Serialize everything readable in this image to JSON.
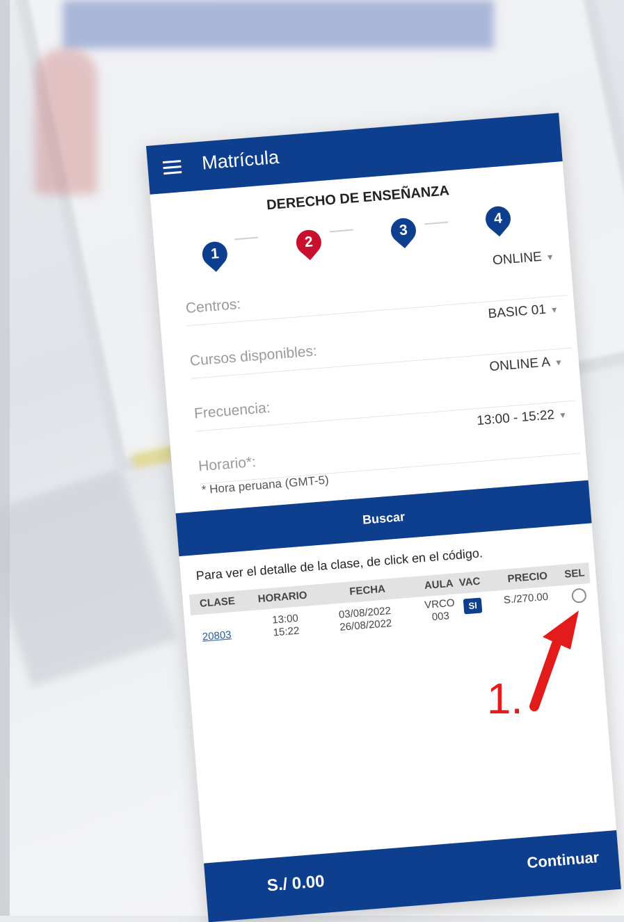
{
  "app": {
    "title": "Matrícula"
  },
  "section_title": "DERECHO DE ENSEÑANZA",
  "steps": [
    {
      "number": "1",
      "color": "#0d3f8e",
      "active": false
    },
    {
      "number": "2",
      "color": "#c8102e",
      "active": true
    },
    {
      "number": "3",
      "color": "#0d3f8e",
      "active": false
    },
    {
      "number": "4",
      "color": "#0d3f8e",
      "active": false
    }
  ],
  "form": {
    "centros": {
      "label": "Centros:",
      "value": "ONLINE"
    },
    "cursos": {
      "label": "Cursos disponibles:",
      "value": "BASIC 01"
    },
    "frecuencia": {
      "label": "Frecuencia:",
      "value": "ONLINE A"
    },
    "horario": {
      "label": "Horario*:",
      "value": "13:00 - 15:22"
    },
    "note": "* Hora peruana (GMT-5)"
  },
  "search_button": "Buscar",
  "info_text": "Para ver el detalle de la clase, de click en el código.",
  "table": {
    "headers": {
      "clase": "CLASE",
      "horario": "HORARIO",
      "fecha": "FECHA",
      "aula": "AULA",
      "vac": "VAC",
      "precio": "PRECIO",
      "sel": "SEL"
    },
    "rows": [
      {
        "clase": "20803",
        "horario_start": "13:00",
        "horario_end": "15:22",
        "fecha_start": "03/08/2022",
        "fecha_end": "26/08/2022",
        "aula_1": "VRCO",
        "aula_2": "003",
        "vac": "SI",
        "precio": "S./270.00"
      }
    ]
  },
  "footer": {
    "total": "S./ 0.00",
    "continue": "Continuar"
  },
  "annotation": {
    "label": "1.",
    "color": "#e31b1b"
  },
  "colors": {
    "primary": "#0d3f8e",
    "accent": "#c8102e"
  }
}
